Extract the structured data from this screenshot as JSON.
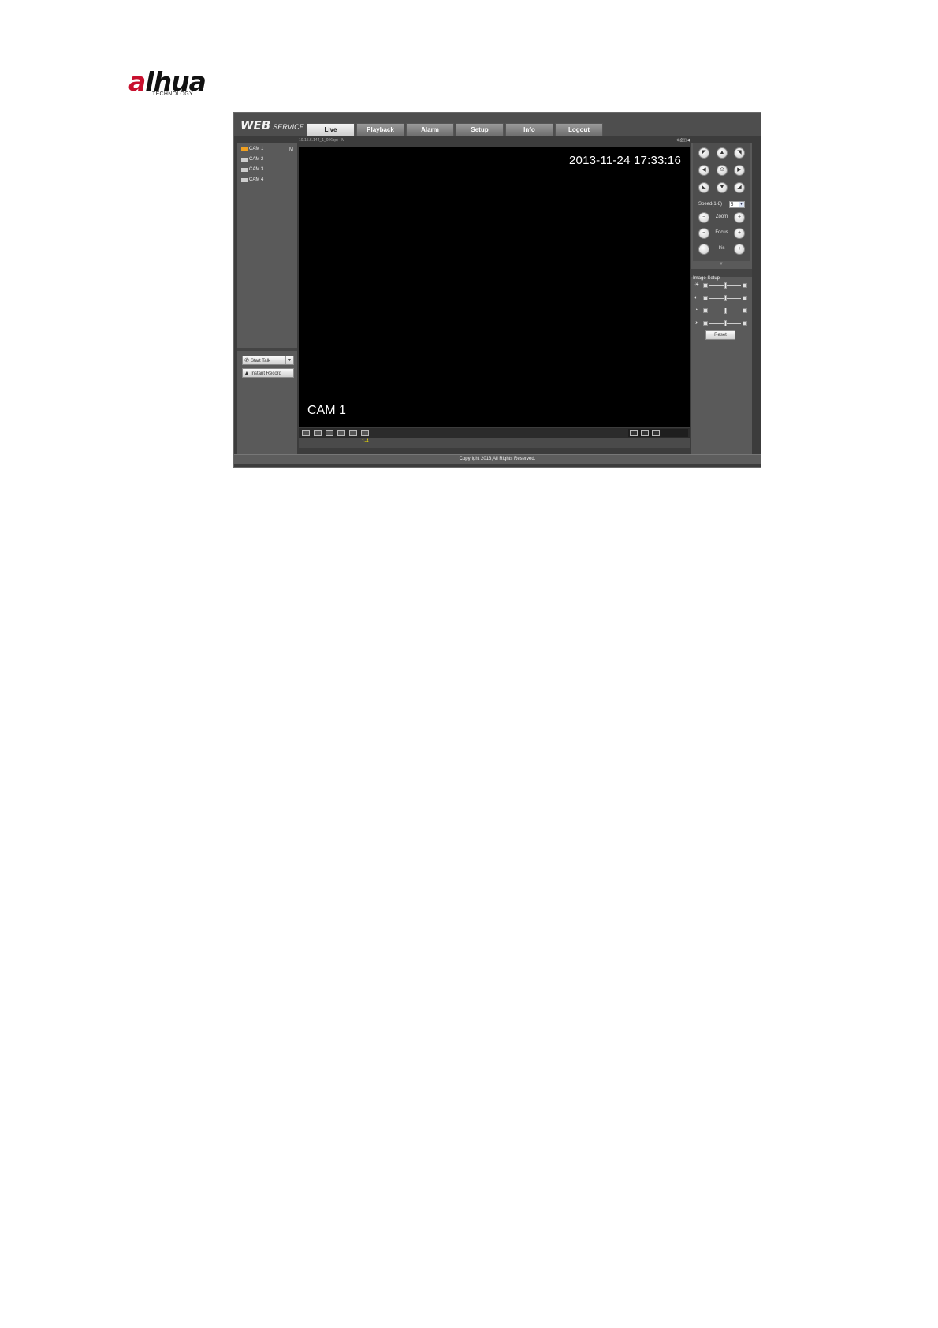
{
  "logo": {
    "word_a": "a",
    "word_hua": "lhua",
    "sub": "TECHNOLOGY"
  },
  "brand": {
    "web": "WEB",
    "service": "SERVICE"
  },
  "tabs": [
    {
      "label": "Live",
      "active": true
    },
    {
      "label": "Playback"
    },
    {
      "label": "Alarm"
    },
    {
      "label": "Setup"
    },
    {
      "label": "Info"
    },
    {
      "label": "Logout"
    }
  ],
  "channels": [
    {
      "label": "CAM 1",
      "active": true
    },
    {
      "label": "CAM 2"
    },
    {
      "label": "CAM 3"
    },
    {
      "label": "CAM 4"
    }
  ],
  "channel_flag": "M",
  "left_buttons": {
    "start_talk": "Start Talk",
    "instant_record": "Instant Record"
  },
  "video": {
    "topinfo": "10.15.6.144_1_0(Kbp) - M",
    "osd_time": "2013-11-24 17:33:16",
    "osd_cam": "CAM 1"
  },
  "page": {
    "current": "1-4"
  },
  "ptz": {
    "speed_label": "Speed(1-8)",
    "speed_value": "5",
    "zoom_label": "Zoom",
    "focus_label": "Focus",
    "iris_label": "Iris"
  },
  "image_setup": {
    "title": "Image Setup",
    "sliders": [
      {
        "name": "brightness",
        "icon": "sun-icon",
        "level": 0.5
      },
      {
        "name": "contrast",
        "icon": "contrast-icon",
        "level": 0.5
      },
      {
        "name": "saturation",
        "icon": "saturation-icon",
        "level": 0.5
      },
      {
        "name": "hue",
        "icon": "hue-icon",
        "level": 0.5
      }
    ],
    "reset": "Reset"
  },
  "footer": "Copyright 2013,All Rights Reserved.",
  "colors": {
    "accent": "#c8102e",
    "page_link": "#f5e300",
    "active_cam": "#f0a020"
  }
}
